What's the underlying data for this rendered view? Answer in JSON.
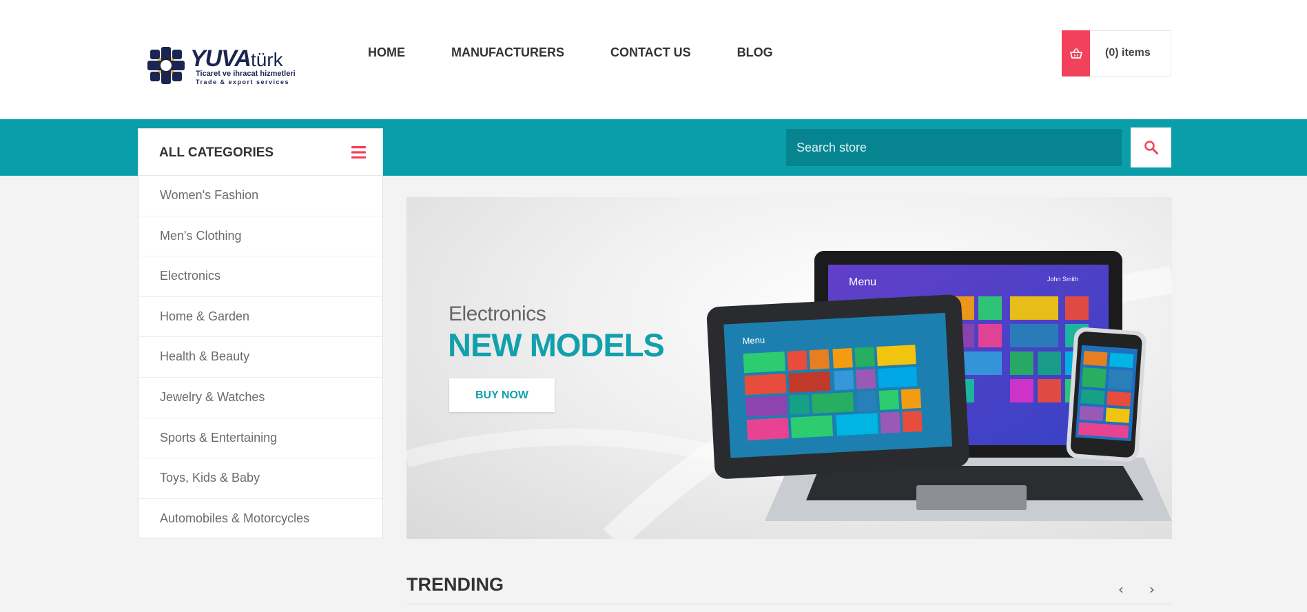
{
  "brand": {
    "name_bold": "YUVA",
    "name_light": "türk",
    "tagline": "Ticaret ve ihracat hizmetleri",
    "tagline_en": "Trade & export services",
    "colors": {
      "navy": "#1b2552",
      "gold": "#f5b800"
    }
  },
  "nav": {
    "items": [
      "HOME",
      "MANUFACTURERS",
      "CONTACT US",
      "BLOG"
    ]
  },
  "cart": {
    "label": "(0) items",
    "icon": "basket-icon"
  },
  "search": {
    "placeholder": "Search store",
    "icon": "search-icon"
  },
  "categories": {
    "title": "ALL CATEGORIES",
    "menu_icon": "hamburger-icon",
    "items": [
      "Women's Fashion",
      "Men's Clothing",
      "Electronics",
      "Home & Garden",
      "Health & Beauty",
      "Jewelry & Watches",
      "Sports & Entertaining",
      "Toys, Kids & Baby",
      "Automobiles & Motorcycles"
    ]
  },
  "banner": {
    "subtitle": "Electronics",
    "title": "NEW MODELS",
    "cta": "BUY NOW",
    "screen_menu_label": "Menu",
    "screen_user": "John Smith"
  },
  "trending": {
    "title": "TRENDING",
    "prev_icon": "chevron-left-icon",
    "next_icon": "chevron-right-icon"
  },
  "theme": {
    "accent": "#f2415a",
    "teal": "#0a9eaa",
    "teal_dark": "#068490"
  }
}
